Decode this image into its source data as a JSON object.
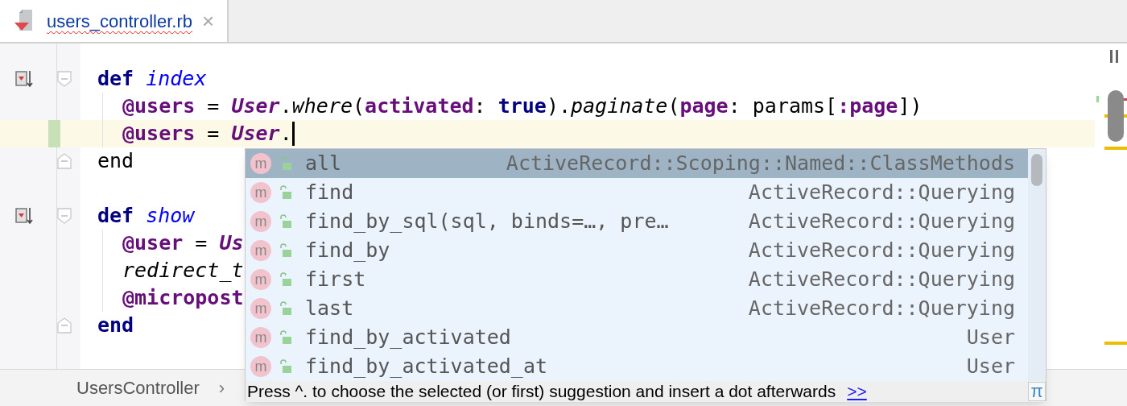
{
  "tab": {
    "title": "users_controller.rb",
    "close": "×",
    "selected": true,
    "has_error": true
  },
  "code_lines": [
    {
      "indented": false,
      "bookmark": true,
      "fold_open": true,
      "fold_close": false,
      "current": false,
      "caret": false,
      "tokens": [
        {
          "kind": "keyword",
          "text": "def "
        },
        {
          "kind": "method_def",
          "text": "index"
        }
      ]
    },
    {
      "indented": true,
      "bookmark": false,
      "fold_open": false,
      "fold_close": false,
      "current": false,
      "caret": false,
      "tokens": [
        {
          "kind": "ivar",
          "text": "@users"
        },
        {
          "kind": "plain",
          "text": " = "
        },
        {
          "kind": "constant",
          "text": "User"
        },
        {
          "kind": "plain",
          "text": "."
        },
        {
          "kind": "call",
          "text": "where"
        },
        {
          "kind": "plain",
          "text": "("
        },
        {
          "kind": "ivar",
          "text": "activated"
        },
        {
          "kind": "plain",
          "text": ": "
        },
        {
          "kind": "keyword",
          "text": "true"
        },
        {
          "kind": "plain",
          "text": ")."
        },
        {
          "kind": "call",
          "text": "paginate"
        },
        {
          "kind": "plain",
          "text": "("
        },
        {
          "kind": "ivar",
          "text": "page"
        },
        {
          "kind": "plain",
          "text": ": params["
        },
        {
          "kind": "ivar",
          "text": ":page"
        },
        {
          "kind": "plain",
          "text": "])"
        }
      ]
    },
    {
      "indented": true,
      "bookmark": false,
      "fold_open": false,
      "fold_close": false,
      "current": true,
      "caret": true,
      "tokens": [
        {
          "kind": "ivar",
          "text": "@users"
        },
        {
          "kind": "plain",
          "text": " = "
        },
        {
          "kind": "constant",
          "text": "User"
        },
        {
          "kind": "plain",
          "text": "."
        }
      ]
    },
    {
      "indented": false,
      "bookmark": false,
      "fold_open": false,
      "fold_close": true,
      "current": false,
      "caret": false,
      "tokens": [
        {
          "kind": "plain",
          "text": "end"
        }
      ]
    },
    {
      "indented": false,
      "bookmark": false,
      "fold_open": false,
      "fold_close": false,
      "current": false,
      "caret": false
    },
    {
      "indented": false,
      "bookmark": true,
      "fold_open": true,
      "fold_close": false,
      "current": false,
      "caret": false,
      "tokens": [
        {
          "kind": "keyword",
          "text": "def "
        },
        {
          "kind": "method_def",
          "text": "show"
        }
      ]
    },
    {
      "indented": true,
      "bookmark": false,
      "fold_open": false,
      "fold_close": false,
      "current": false,
      "caret": false,
      "tokens": [
        {
          "kind": "ivar",
          "text": "@user"
        },
        {
          "kind": "plain",
          "text": " = "
        },
        {
          "kind": "constant",
          "text": "Us"
        }
      ]
    },
    {
      "indented": true,
      "bookmark": false,
      "fold_open": false,
      "fold_close": false,
      "current": false,
      "caret": false,
      "tokens": [
        {
          "kind": "call",
          "text": "redirect_t"
        }
      ]
    },
    {
      "indented": true,
      "bookmark": false,
      "fold_open": false,
      "fold_close": false,
      "current": false,
      "caret": false,
      "tokens": [
        {
          "kind": "ivar",
          "text": "@micropost"
        }
      ]
    },
    {
      "indented": false,
      "bookmark": false,
      "fold_open": false,
      "fold_close": true,
      "current": false,
      "caret": false,
      "tokens": [
        {
          "kind": "keyword",
          "text": "end"
        }
      ]
    }
  ],
  "breadcrumb": {
    "items": [
      "UsersController"
    ],
    "separator": "›"
  },
  "completion": {
    "items": [
      {
        "icon": "m",
        "name": "all",
        "owner": "ActiveRecord::Scoping::Named::ClassMethods",
        "selected": true
      },
      {
        "icon": "m",
        "name": "find",
        "owner": "ActiveRecord::Querying",
        "selected": false
      },
      {
        "icon": "m",
        "name": "find_by_sql(sql, binds=…, pre…",
        "owner": "ActiveRecord::Querying",
        "selected": false
      },
      {
        "icon": "m",
        "name": "find_by",
        "owner": "ActiveRecord::Querying",
        "selected": false
      },
      {
        "icon": "m",
        "name": "first",
        "owner": "ActiveRecord::Querying",
        "selected": false
      },
      {
        "icon": "m",
        "name": "last",
        "owner": "ActiveRecord::Querying",
        "selected": false
      },
      {
        "icon": "m",
        "name": "find_by_activated",
        "owner": "User",
        "selected": false
      },
      {
        "icon": "m",
        "name": "find_by_activated_at",
        "owner": "User",
        "selected": false
      }
    ],
    "hint": "Press ^. to choose the selected (or first) suggestion and insert a dot afterwards",
    "hint_link": ">>",
    "pi": "π"
  }
}
